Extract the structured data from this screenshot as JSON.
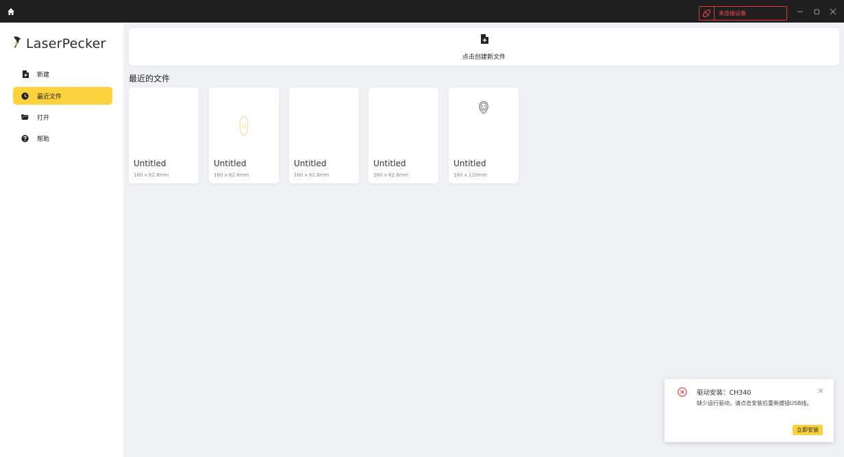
{
  "titlebar": {
    "device_status": "未连接设备"
  },
  "sidebar": {
    "logo_text": "LaserPecker",
    "items": [
      {
        "label": "新建",
        "icon": "new-file-icon"
      },
      {
        "label": "最近文件",
        "icon": "clock-icon",
        "active": true
      },
      {
        "label": "打开",
        "icon": "folder-icon"
      },
      {
        "label": "帮助",
        "icon": "help-icon"
      }
    ]
  },
  "main": {
    "create_label": "点击创建新文件",
    "section_title": "最近的文件",
    "files": [
      {
        "name": "Untitled",
        "size": "160 x 62.8mm"
      },
      {
        "name": "Untitled",
        "size": "160 x 62.8mm"
      },
      {
        "name": "Untitled",
        "size": "160 x 62.8mm"
      },
      {
        "name": "Untitled",
        "size": "160 x 62.8mm"
      },
      {
        "name": "Untitled",
        "size": "160 x 120mm"
      }
    ]
  },
  "toast": {
    "title": "驱动安装：CH340",
    "message": "缺少运行驱动，请点击安装后重新拔插USB线。",
    "button": "立即安装"
  },
  "colors": {
    "accent": "#fcd23d",
    "titlebar": "#1f1f1f",
    "error": "#e33333",
    "background": "#f0f1f5"
  }
}
